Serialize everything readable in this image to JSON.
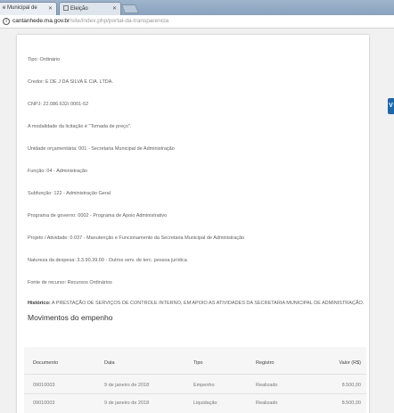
{
  "browser": {
    "tabs": [
      {
        "label": "e Municipal de"
      },
      {
        "label": "Eleição"
      }
    ],
    "url_host": "cantanhede.ma.gov.br",
    "url_path": "/site/index.php/portal-da-transparencia"
  },
  "empenho": {
    "fields": [
      "Tipo: Ordinário",
      "Credor: E DE J DA SILVA E CIA. LTDA.",
      "CNPJ: 22.086.632/ 0001-52",
      "A modalidade da licitação é \"Tomada de preço\".",
      "Unidade orçamentária: 001 - Secretaria Municipal de Administração",
      "Função: 04 - Administração",
      "Subfunção: 122 - Administração Geral",
      "Programa de governo: 0002 - Programa de Apoio Administrativo",
      "Projeto / Atividade: 0.037 - Manutenção e Funcionamento da Secretaria Municipal de Administração",
      "Natureza da despesa: 3.3.90.39.00 - Outros serv. de terc. pessoa jurídica",
      "Fonte de recurso: Recursos Ordinários"
    ],
    "historico_label": "Histórico:",
    "historico_text": " A PRESTAÇÃO DE SERVIÇOS DE CONTROLE INTERNO, EM APOIO AS ATIVIDADES DA SECRETARIA MUNICIPAL DE ADMINISTRAÇÃO."
  },
  "movimentos": {
    "title": "Movimentos do empenho",
    "columns": [
      "Documento",
      "Data",
      "Tipo",
      "Registro",
      "Valor (R$)"
    ],
    "rows": [
      [
        "09010003",
        "9 de janeiro de 2018",
        "Empenho",
        "Realizado",
        "8.500,00"
      ],
      [
        "09010003",
        "9 de janeiro de 2018",
        "Liquidação",
        "Realizado",
        "8.500,00"
      ]
    ]
  },
  "side_widget": {
    "label": "V",
    "color": "#1e67a8"
  }
}
